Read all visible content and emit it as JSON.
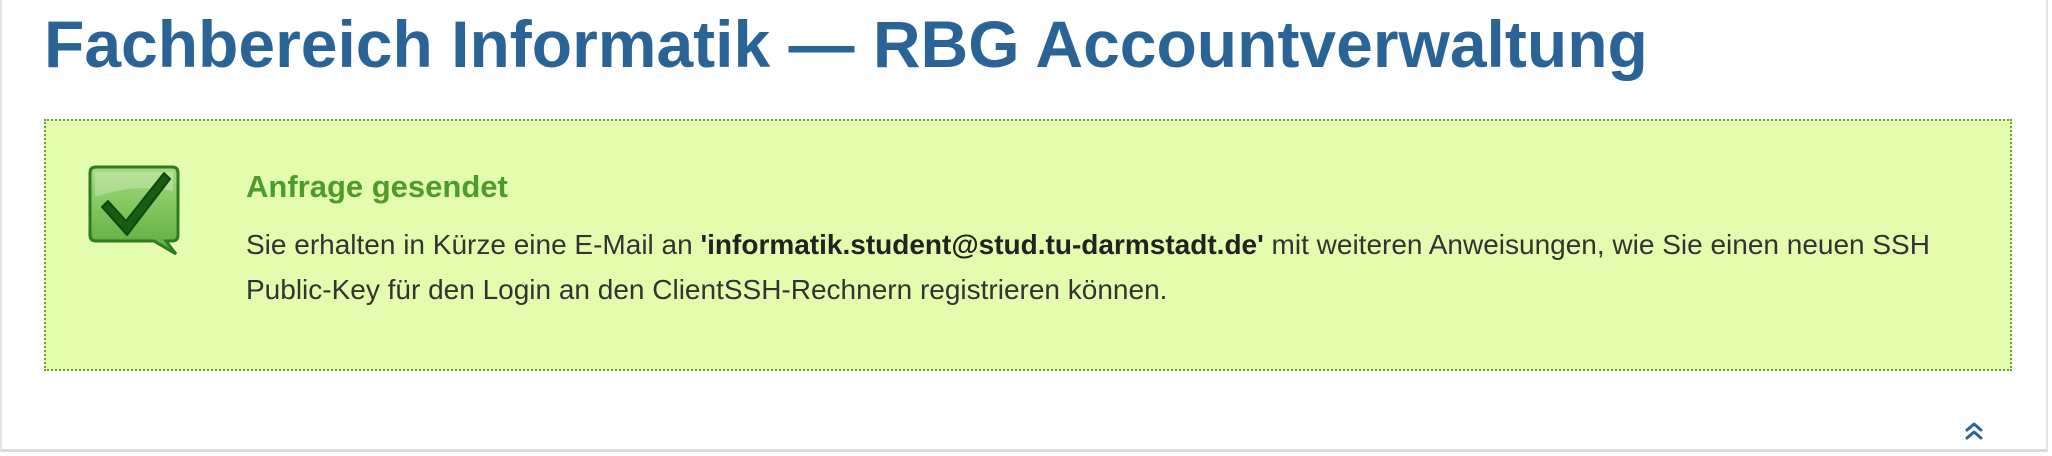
{
  "header": {
    "title": "Fachbereich Informatik — RBG Accountverwaltung"
  },
  "message": {
    "status": "success",
    "icon": "checkmark-speech-bubble-icon",
    "title": "Anfrage gesendet",
    "text_before": "Sie erhalten in Kürze eine E-Mail an ",
    "email": "'informatik.student@stud.tu-darmstadt.de'",
    "text_after": " mit weiteren Anweisungen, wie Sie einen neuen SSH Public-Key für den Login an den ClientSSH-Rechnern registrieren können."
  },
  "footer": {
    "scroll_top_icon": "double-chevron-up-icon"
  },
  "colors": {
    "title": "#2a6496",
    "success_background": "#e3fcae",
    "success_border": "#6aa13a",
    "success_title": "#4b9d28",
    "body_text": "#333333"
  }
}
